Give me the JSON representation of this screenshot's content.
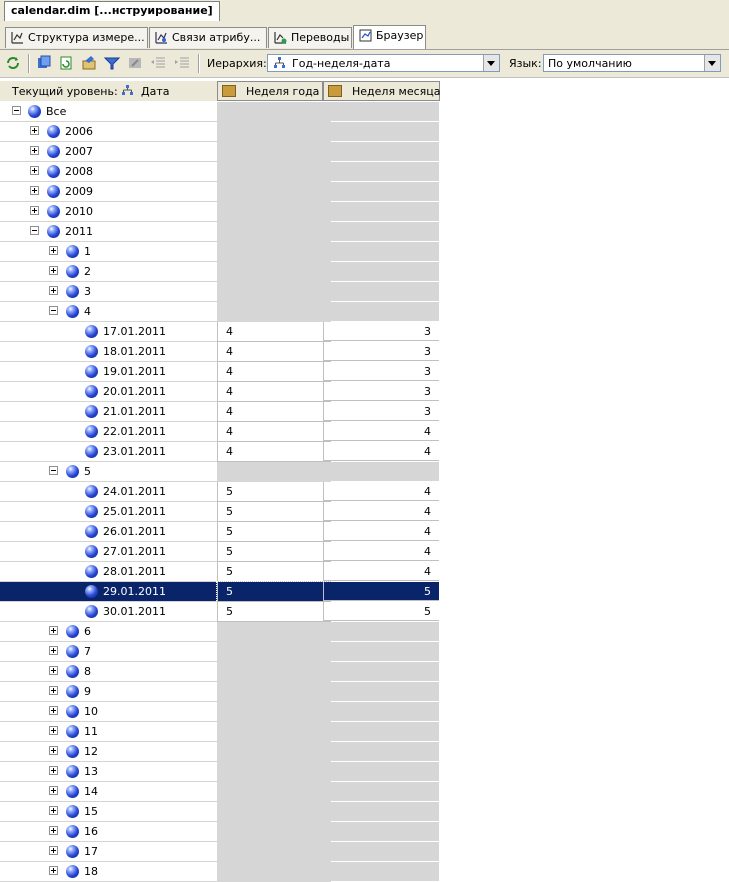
{
  "document_tab": "calendar.dim [...нструирование]",
  "view_tabs": [
    {
      "label": "Структура измере...",
      "icon": "dimension-structure-icon"
    },
    {
      "label": "Связи атрибу...",
      "icon": "attribute-relationships-icon"
    },
    {
      "label": "Переводы",
      "icon": "translations-icon"
    },
    {
      "label": "Браузер",
      "icon": "browser-icon",
      "active": true
    }
  ],
  "toolbar": {
    "hierarchy_label": "Иерархия:",
    "hierarchy_value": "Год-неделя-дата",
    "language_label": "Язык:",
    "language_value": "По умолчанию"
  },
  "grid": {
    "current_level_label": "Текущий уровень:",
    "current_level_value": "Дата",
    "columns": [
      "Неделя года",
      "Неделя месяца"
    ],
    "rows": [
      {
        "label": "Все",
        "level": 0,
        "exp": "minus"
      },
      {
        "label": "2006",
        "level": 1,
        "exp": "plus"
      },
      {
        "label": "2007",
        "level": 1,
        "exp": "plus"
      },
      {
        "label": "2008",
        "level": 1,
        "exp": "plus"
      },
      {
        "label": "2009",
        "level": 1,
        "exp": "plus"
      },
      {
        "label": "2010",
        "level": 1,
        "exp": "plus"
      },
      {
        "label": "2011",
        "level": 1,
        "exp": "minus"
      },
      {
        "label": "1",
        "level": 2,
        "exp": "plus"
      },
      {
        "label": "2",
        "level": 2,
        "exp": "plus"
      },
      {
        "label": "3",
        "level": 2,
        "exp": "plus"
      },
      {
        "label": "4",
        "level": 2,
        "exp": "minus"
      },
      {
        "label": "17.01.2011",
        "level": 3,
        "wy": "4",
        "wm": "3"
      },
      {
        "label": "18.01.2011",
        "level": 3,
        "wy": "4",
        "wm": "3"
      },
      {
        "label": "19.01.2011",
        "level": 3,
        "wy": "4",
        "wm": "3"
      },
      {
        "label": "20.01.2011",
        "level": 3,
        "wy": "4",
        "wm": "3"
      },
      {
        "label": "21.01.2011",
        "level": 3,
        "wy": "4",
        "wm": "3"
      },
      {
        "label": "22.01.2011",
        "level": 3,
        "wy": "4",
        "wm": "4"
      },
      {
        "label": "23.01.2011",
        "level": 3,
        "wy": "4",
        "wm": "4"
      },
      {
        "label": "5",
        "level": 2,
        "exp": "minus"
      },
      {
        "label": "24.01.2011",
        "level": 3,
        "wy": "5",
        "wm": "4"
      },
      {
        "label": "25.01.2011",
        "level": 3,
        "wy": "5",
        "wm": "4"
      },
      {
        "label": "26.01.2011",
        "level": 3,
        "wy": "5",
        "wm": "4"
      },
      {
        "label": "27.01.2011",
        "level": 3,
        "wy": "5",
        "wm": "4"
      },
      {
        "label": "28.01.2011",
        "level": 3,
        "wy": "5",
        "wm": "4"
      },
      {
        "label": "29.01.2011",
        "level": 3,
        "wy": "5",
        "wm": "5",
        "selected": true
      },
      {
        "label": "30.01.2011",
        "level": 3,
        "wy": "5",
        "wm": "5"
      },
      {
        "label": "6",
        "level": 2,
        "exp": "plus"
      },
      {
        "label": "7",
        "level": 2,
        "exp": "plus"
      },
      {
        "label": "8",
        "level": 2,
        "exp": "plus"
      },
      {
        "label": "9",
        "level": 2,
        "exp": "plus"
      },
      {
        "label": "10",
        "level": 2,
        "exp": "plus"
      },
      {
        "label": "11",
        "level": 2,
        "exp": "plus"
      },
      {
        "label": "12",
        "level": 2,
        "exp": "plus"
      },
      {
        "label": "13",
        "level": 2,
        "exp": "plus"
      },
      {
        "label": "14",
        "level": 2,
        "exp": "plus"
      },
      {
        "label": "15",
        "level": 2,
        "exp": "plus"
      },
      {
        "label": "16",
        "level": 2,
        "exp": "plus"
      },
      {
        "label": "17",
        "level": 2,
        "exp": "plus"
      },
      {
        "label": "18",
        "level": 2,
        "exp": "plus"
      }
    ]
  },
  "colors": {
    "selection": "#0a246a",
    "empty_cell": "#d6d6d6",
    "chrome": "#ece9d8"
  }
}
